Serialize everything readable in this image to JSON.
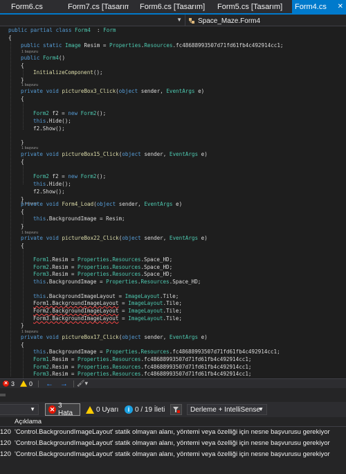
{
  "tabs": [
    {
      "label": "Form6.cs",
      "active": false
    },
    {
      "label": "Form7.cs [Tasarım]",
      "active": false
    },
    {
      "label": "Form6.cs [Tasarım]",
      "active": false
    },
    {
      "label": "Form5.cs [Tasarım]",
      "active": false
    },
    {
      "label": "Form4.cs",
      "active": true
    }
  ],
  "active_tab_close": "✕",
  "navbar": {
    "left_value": "",
    "right_value": "Space_Maze.Form4"
  },
  "code_lens_label": "1 başvuru",
  "code": {
    "class_decl": [
      [
        "kw",
        "public partial class "
      ],
      [
        "ty",
        "Form4"
      ],
      [
        "",
        "  : "
      ],
      [
        "ty",
        "Form"
      ]
    ],
    "open_brace": "{",
    "resim_decl": [
      [
        "kw",
        "public static "
      ],
      [
        "ty",
        "Image"
      ],
      [
        "",
        " Resim = "
      ],
      [
        "ty",
        "Properties"
      ],
      [
        "",
        "."
      ],
      [
        "ty",
        "Resources"
      ],
      [
        "",
        ".fc48688993507d71fd61fb4c492914cc1;"
      ]
    ],
    "ctor_decl": [
      [
        "kw",
        "public "
      ],
      [
        "ty",
        "Form4"
      ],
      [
        "",
        "()"
      ]
    ],
    "init_call": [
      [
        "mt",
        "InitializeComponent"
      ],
      [
        "",
        "();"
      ]
    ],
    "pb3_decl": [
      [
        "kw",
        "private void "
      ],
      [
        "mt",
        "pictureBox3_Click"
      ],
      [
        "",
        "("
      ],
      [
        "kw",
        "object"
      ],
      [
        "",
        " sender, "
      ],
      [
        "ty",
        "EventArgs"
      ],
      [
        "",
        " e)"
      ]
    ],
    "form2_new": [
      [
        "ty",
        "Form2"
      ],
      [
        "",
        " f2 = "
      ],
      [
        "kw",
        "new "
      ],
      [
        "ty",
        "Form2"
      ],
      [
        "",
        "();"
      ]
    ],
    "this_hide": [
      [
        "kw",
        "this"
      ],
      [
        "",
        ".Hide();"
      ]
    ],
    "f2_show": "f2.Show();",
    "pb15_decl": [
      [
        "kw",
        "private void "
      ],
      [
        "mt",
        "pictureBox15_Click"
      ],
      [
        "",
        "("
      ],
      [
        "kw",
        "object"
      ],
      [
        "",
        " sender, "
      ],
      [
        "ty",
        "EventArgs"
      ],
      [
        "",
        " e)"
      ]
    ],
    "load_decl": [
      [
        "kw",
        "private void "
      ],
      [
        "mt",
        "Form4_Load"
      ],
      [
        "",
        "("
      ],
      [
        "kw",
        "object"
      ],
      [
        "",
        " sender, "
      ],
      [
        "ty",
        "EventArgs"
      ],
      [
        "",
        " e)"
      ]
    ],
    "bg_resim": [
      [
        "kw",
        "this"
      ],
      [
        "",
        ".BackgroundImage = Resim;"
      ]
    ],
    "pb22_decl": [
      [
        "kw",
        "private void "
      ],
      [
        "mt",
        "pictureBox22_Click"
      ],
      [
        "",
        "("
      ],
      [
        "kw",
        "object"
      ],
      [
        "",
        " sender, "
      ],
      [
        "ty",
        "EventArgs"
      ],
      [
        "",
        " e)"
      ]
    ],
    "f1_resim_hd": [
      [
        "ty",
        "Form1"
      ],
      [
        "",
        ".Resim = "
      ],
      [
        "ty",
        "Properties"
      ],
      [
        "",
        "."
      ],
      [
        "ty",
        "Resources"
      ],
      [
        "",
        ".Space_HD;"
      ]
    ],
    "f2_resim_hd": [
      [
        "ty",
        "Form2"
      ],
      [
        "",
        ".Resim = "
      ],
      [
        "ty",
        "Properties"
      ],
      [
        "",
        "."
      ],
      [
        "ty",
        "Resources"
      ],
      [
        "",
        ".Space_HD;"
      ]
    ],
    "f3_resim_hd": [
      [
        "ty",
        "Form3"
      ],
      [
        "",
        ".Resim = "
      ],
      [
        "ty",
        "Properties"
      ],
      [
        "",
        "."
      ],
      [
        "ty",
        "Resources"
      ],
      [
        "",
        ".Space_HD;"
      ]
    ],
    "this_bg_hd": [
      [
        "kw",
        "this"
      ],
      [
        "",
        ".BackgroundImage = "
      ],
      [
        "ty",
        "Properties"
      ],
      [
        "",
        "."
      ],
      [
        "ty",
        "Resources"
      ],
      [
        "",
        ".Space_HD;"
      ]
    ],
    "this_layout": [
      [
        "kw",
        "this"
      ],
      [
        "",
        ".BackgroundImageLayout = "
      ],
      [
        "ty",
        "ImageLayout"
      ],
      [
        "",
        ".Tile;"
      ]
    ],
    "f1_layout": [
      [
        "err",
        "Form1.BackgroundImageLayout"
      ],
      [
        "",
        " = "
      ],
      [
        "ty",
        "ImageLayout"
      ],
      [
        "",
        ".Tile;"
      ]
    ],
    "f2_layout": [
      [
        "err",
        "Form2.BackgroundImageLayout"
      ],
      [
        "",
        " = "
      ],
      [
        "ty",
        "ImageLayout"
      ],
      [
        "",
        ".Tile;"
      ]
    ],
    "f3_layout": [
      [
        "err",
        "Form3.BackgroundImageLayout"
      ],
      [
        "",
        " = "
      ],
      [
        "ty",
        "ImageLayout"
      ],
      [
        "",
        ".Tile;"
      ]
    ],
    "pb17_decl": [
      [
        "kw",
        "private void "
      ],
      [
        "mt",
        "pictureBox17_Click"
      ],
      [
        "",
        "("
      ],
      [
        "kw",
        "object"
      ],
      [
        "",
        " sender, "
      ],
      [
        "ty",
        "EventArgs"
      ],
      [
        "",
        " e)"
      ]
    ],
    "this_bg_fc": [
      [
        "kw",
        "this"
      ],
      [
        "",
        ".BackgroundImage = "
      ],
      [
        "ty",
        "Properties"
      ],
      [
        "",
        "."
      ],
      [
        "ty",
        "Resources"
      ],
      [
        "",
        ".fc48688993507d71fd61fb4c492914cc1;"
      ]
    ],
    "f1_resim_fc": [
      [
        "ty",
        "Form1"
      ],
      [
        "",
        ".Resim = "
      ],
      [
        "ty",
        "Properties"
      ],
      [
        "",
        "."
      ],
      [
        "ty",
        "Resources"
      ],
      [
        "",
        ".fc48688993507d71fd61fb4c492914cc1;"
      ]
    ],
    "f2_resim_fc": [
      [
        "ty",
        "Form2"
      ],
      [
        "",
        ".Resim = "
      ],
      [
        "ty",
        "Properties"
      ],
      [
        "",
        "."
      ],
      [
        "ty",
        "Resources"
      ],
      [
        "",
        ".fc48688993507d71fd61fb4c492914cc1;"
      ]
    ],
    "f3_resim_fc": [
      [
        "ty",
        "Form3"
      ],
      [
        "",
        ".Resim = "
      ],
      [
        "ty",
        "Properties"
      ],
      [
        "",
        "."
      ],
      [
        "ty",
        "Resources"
      ],
      [
        "",
        ".fc48688993507d71fd61fb4c492914cc1;"
      ]
    ],
    "close_brace": "}"
  },
  "editor_status": {
    "error_count": "3",
    "warning_count": "0"
  },
  "error_toolbar": {
    "errors_label": "3 Hata",
    "warnings_label": "0 Uyarı",
    "messages_label": "0 / 19 İleti",
    "build_filter": "Derleme + IntelliSense"
  },
  "error_list": {
    "header": "Açıklama",
    "rows": [
      {
        "code": "120",
        "description": "'Control.BackgroundImageLayout' statik olmayan alanı, yöntemi veya özelliği için nesne başvurusu gerekiyor"
      },
      {
        "code": "120",
        "description": "'Control.BackgroundImageLayout' statik olmayan alanı, yöntemi veya özelliği için nesne başvurusu gerekiyor"
      },
      {
        "code": "120",
        "description": "'Control.BackgroundImageLayout' statik olmayan alanı, yöntemi veya özelliği için nesne başvurusu gerekiyor"
      }
    ]
  },
  "colors": {
    "accent": "#007acc",
    "error": "#e51400",
    "warning": "#ffcc00",
    "info": "#1ba1e2"
  }
}
